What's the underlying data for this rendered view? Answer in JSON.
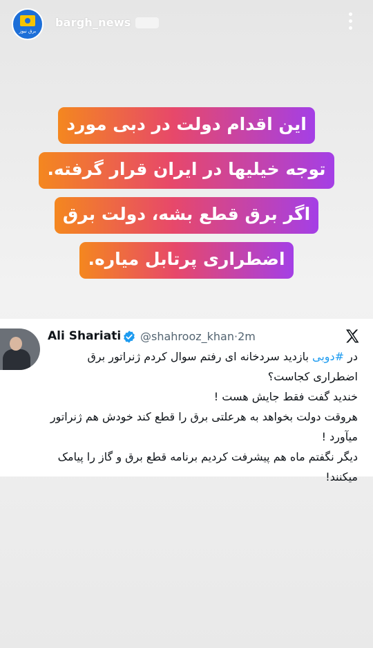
{
  "story": {
    "account": {
      "username": "bargh_news",
      "avatar_label": "برق نیوز"
    },
    "headline_lines": [
      "این اقدام دولت در دبی مورد",
      "توجه خیلیها در ایران قرار گرفته.",
      "اگر برق قطع بشه، دولت برق",
      "اضطراری پرتابل میاره."
    ]
  },
  "tweet": {
    "author_name": "Ali Shariati",
    "handle": "@shahrooz_khan",
    "separator": "·",
    "time": "2m",
    "hashtag": "#دوبی",
    "line1_prefix": "در ",
    "line1_rest": " بازدید سردخانه ای رفتم سوال کردم ژنراتور برق اضطراری کجاست؟",
    "line2": "خندید گفت فقط جایش هست !",
    "line3": "هروقت دولت بخواهد به هرعلتی برق را قطع کند خودش هم ژنراتور میآورد !",
    "line4": "دیگر نگفتم ماه هم پیشرفت کردیم برنامه قطع برق و گاز را پیامک میکنند!"
  },
  "icons": {
    "verified": "verified-badge-icon",
    "platform": "x-logo-icon",
    "menu": "more-vertical-icon"
  },
  "colors": {
    "gradient_start": "#f4871f",
    "gradient_mid": "#e7486a",
    "gradient_end": "#a43fe6",
    "link": "#1d9bf0",
    "verified": "#1d9bf0"
  }
}
